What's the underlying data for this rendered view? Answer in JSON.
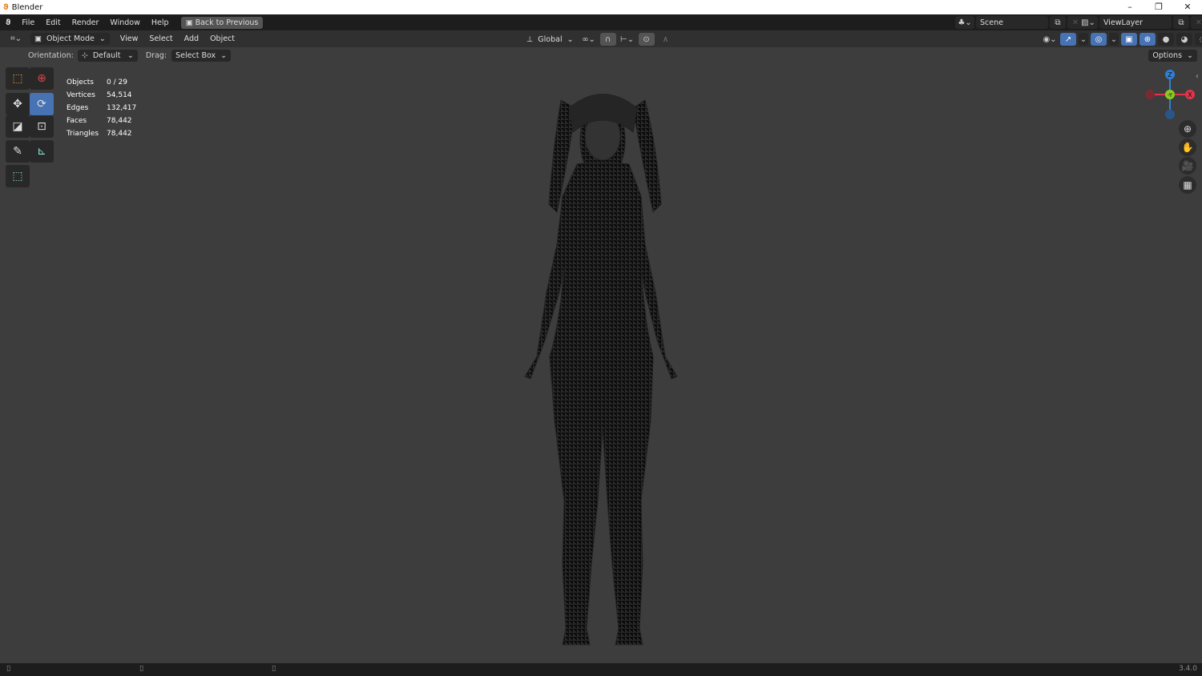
{
  "window": {
    "title": "Blender",
    "minimize": "–",
    "restore": "❐",
    "close": "✕"
  },
  "menubar": {
    "items": [
      "File",
      "Edit",
      "Render",
      "Window",
      "Help"
    ],
    "back_button": "Back to Previous",
    "scene": "Scene",
    "view_layer": "ViewLayer"
  },
  "header": {
    "mode": "Object Mode",
    "menus": [
      "View",
      "Select",
      "Add",
      "Object"
    ],
    "transform_orientation": "Global"
  },
  "tool_settings": {
    "orientation_label": "Orientation:",
    "orientation_value": "Default",
    "drag_label": "Drag:",
    "drag_value": "Select Box",
    "options": "Options"
  },
  "stats": [
    {
      "label": "Objects",
      "value": "0 / 29"
    },
    {
      "label": "Vertices",
      "value": "54,514"
    },
    {
      "label": "Edges",
      "value": "132,417"
    },
    {
      "label": "Faces",
      "value": "78,442"
    },
    {
      "label": "Triangles",
      "value": "78,442"
    }
  ],
  "gizmo": {
    "z": "Z",
    "y": "-Y",
    "x": "X"
  },
  "statusbar": {
    "version": "3.4.0"
  },
  "colors": {
    "accent": "#4772b3",
    "x_axis": "#e0344d",
    "y_axis": "#8bcb1f",
    "z_axis": "#2d7fd8"
  }
}
